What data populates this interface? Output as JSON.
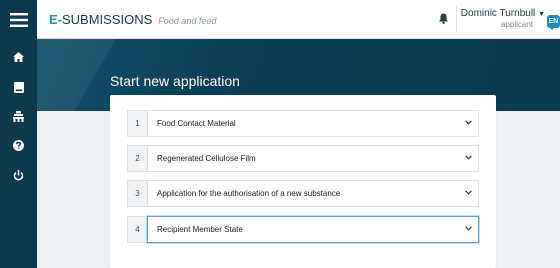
{
  "brand": {
    "prefix": "E-",
    "name": "SUBMISSIONS",
    "subtitle": "Food and feed"
  },
  "user": {
    "name": "Dominic Turnbull",
    "role": "applicant",
    "language": "EN"
  },
  "page": {
    "title": "Start new application"
  },
  "steps": [
    {
      "number": "1",
      "value": "Food Contact Material"
    },
    {
      "number": "2",
      "value": "Regenerated Cellulose Film"
    },
    {
      "number": "3",
      "value": "Application for the authorisation of a new substance"
    },
    {
      "number": "4",
      "value": "Recipient Member State"
    }
  ],
  "icons": {
    "menu": "menu-icon",
    "home": "home-icon",
    "book": "book-icon",
    "users": "users-icon",
    "help": "help-icon",
    "power": "power-icon",
    "notifications": "bell-icon",
    "dropdown": "chevron-down-icon"
  },
  "colors": {
    "sidebar": "#0b3a4f",
    "accent": "#1a8fc6",
    "hero": "#0a3a51"
  }
}
